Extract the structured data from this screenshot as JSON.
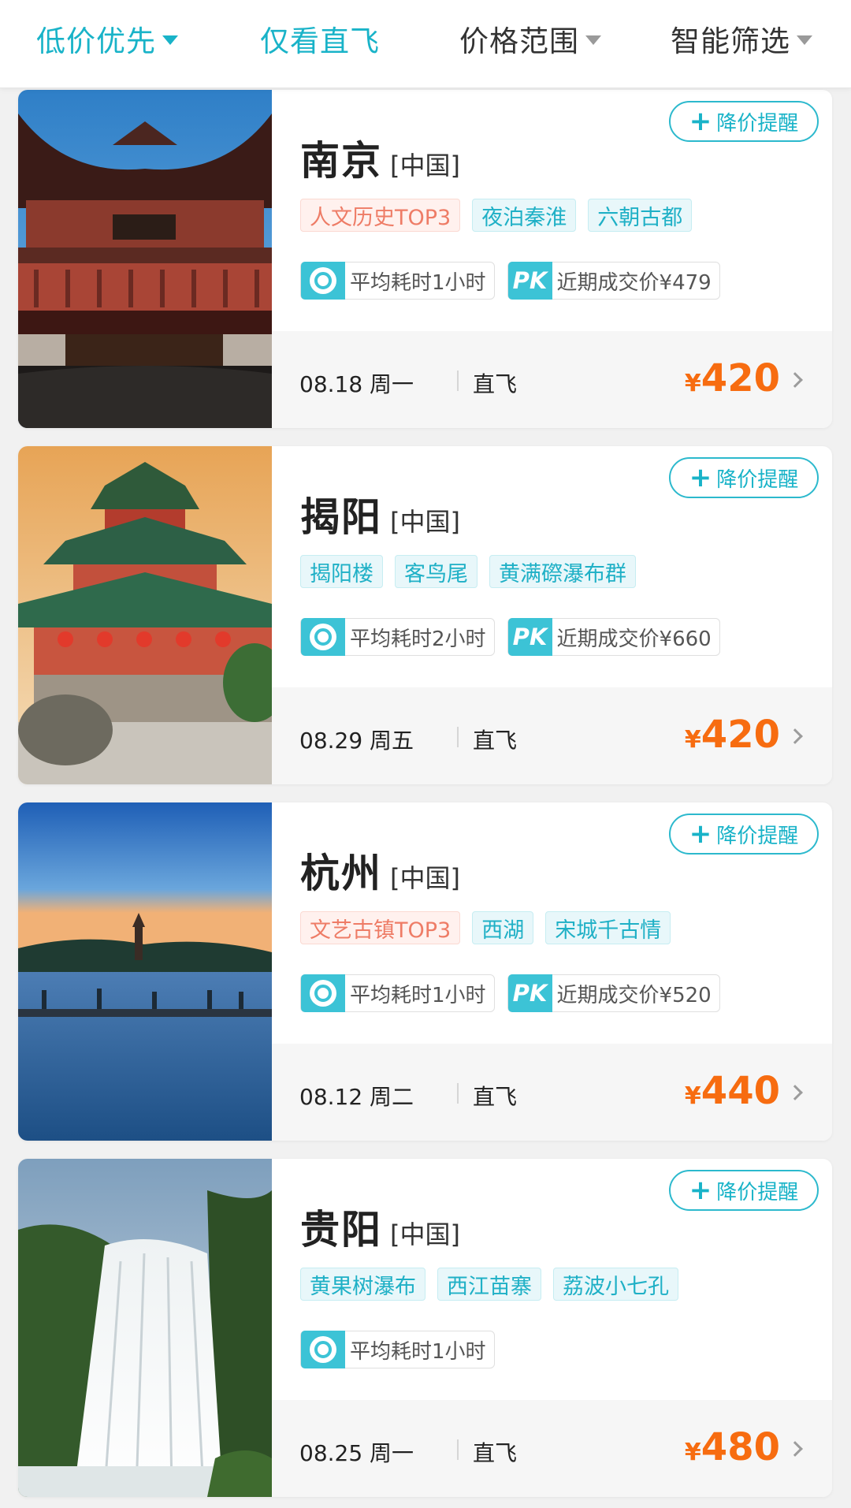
{
  "filters": [
    {
      "label": "低价优先",
      "active": true
    },
    {
      "label": "仅看直飞",
      "active": true
    },
    {
      "label": "价格范围",
      "active": false
    },
    {
      "label": "智能筛选",
      "active": false
    }
  ],
  "accent_color": "#19b3c8",
  "price_color": "#f76c10",
  "icons": {
    "alert": "plus-icon",
    "duration": "clock-icon",
    "compare": "pk-icon",
    "chevron": "chevron-right-icon"
  },
  "cards": [
    {
      "city": "南京",
      "country": "[中国]",
      "alert_label": "降价提醒",
      "tags": [
        {
          "text": "人文历史TOP3",
          "hot": true
        },
        {
          "text": "夜泊秦淮"
        },
        {
          "text": "六朝古都"
        }
      ],
      "duration": "平均耗时1小时",
      "pk_badge": "PK",
      "recent_price": "近期成交价¥479",
      "date": "08.18 周一",
      "flight_type": "直飞",
      "currency": "¥",
      "price": "420"
    },
    {
      "city": "揭阳",
      "country": "[中国]",
      "alert_label": "降价提醒",
      "tags": [
        {
          "text": "揭阳楼"
        },
        {
          "text": "客鸟尾"
        },
        {
          "text": "黄满磜瀑布群"
        }
      ],
      "duration": "平均耗时2小时",
      "pk_badge": "PK",
      "recent_price": "近期成交价¥660",
      "date": "08.29 周五",
      "flight_type": "直飞",
      "currency": "¥",
      "price": "420"
    },
    {
      "city": "杭州",
      "country": "[中国]",
      "alert_label": "降价提醒",
      "tags": [
        {
          "text": "文艺古镇TOP3",
          "hot": true
        },
        {
          "text": "西湖"
        },
        {
          "text": "宋城千古情"
        }
      ],
      "duration": "平均耗时1小时",
      "pk_badge": "PK",
      "recent_price": "近期成交价¥520",
      "date": "08.12 周二",
      "flight_type": "直飞",
      "currency": "¥",
      "price": "440"
    },
    {
      "city": "贵阳",
      "country": "[中国]",
      "alert_label": "降价提醒",
      "tags": [
        {
          "text": "黄果树瀑布"
        },
        {
          "text": "西江苗寨"
        },
        {
          "text": "荔波小七孔"
        }
      ],
      "duration": "平均耗时1小时",
      "pk_badge": null,
      "recent_price": null,
      "date": "08.25 周一",
      "flight_type": "直飞",
      "currency": "¥",
      "price": "480"
    }
  ]
}
